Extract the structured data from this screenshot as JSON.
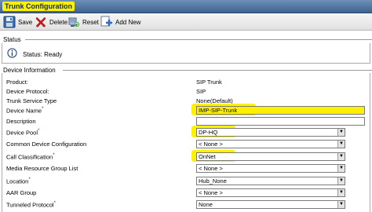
{
  "window": {
    "title": "Trunk Configuration"
  },
  "toolbar": {
    "save": {
      "label": "Save",
      "icon": "save-icon"
    },
    "delete": {
      "label": "Delete",
      "icon": "delete-x-icon"
    },
    "reset": {
      "label": "Reset",
      "icon": "reset-icon"
    },
    "add_new": {
      "label": "Add New",
      "icon": "add-new-icon"
    }
  },
  "status_section": {
    "header": "Status",
    "message": "Status: Ready",
    "icon": "info-icon"
  },
  "device_section": {
    "header": "Device Information",
    "fields": {
      "product": {
        "label": "Product:",
        "value": "SIP Trunk"
      },
      "protocol": {
        "label": "Device Protocol:",
        "value": "SIP"
      },
      "service_type": {
        "label": "Trunk Service Type",
        "value": "None(Default)"
      },
      "device_name": {
        "label": "Device Name",
        "value": "IMP-SIP-Trunk"
      },
      "description": {
        "label": "Description",
        "value": ""
      },
      "device_pool": {
        "label": "Device Pool",
        "value": "DP-HQ"
      },
      "common_config": {
        "label": "Common Device Configuration",
        "value": "< None >"
      },
      "call_classification": {
        "label": "Call Classification",
        "value": "OnNet"
      },
      "mrgl": {
        "label": "Media Resource Group List",
        "value": "< None >"
      },
      "location": {
        "label": "Location",
        "value": "Hub_None"
      },
      "aar_group": {
        "label": "AAR Group",
        "value": "< None >"
      },
      "tunneled_protocol": {
        "label": "Tunneled Protocol",
        "value": "None"
      }
    }
  },
  "required_marker": "*",
  "colors": {
    "title_bar": "#3f6390",
    "highlight": "#fff100",
    "required": "#cc0000"
  }
}
